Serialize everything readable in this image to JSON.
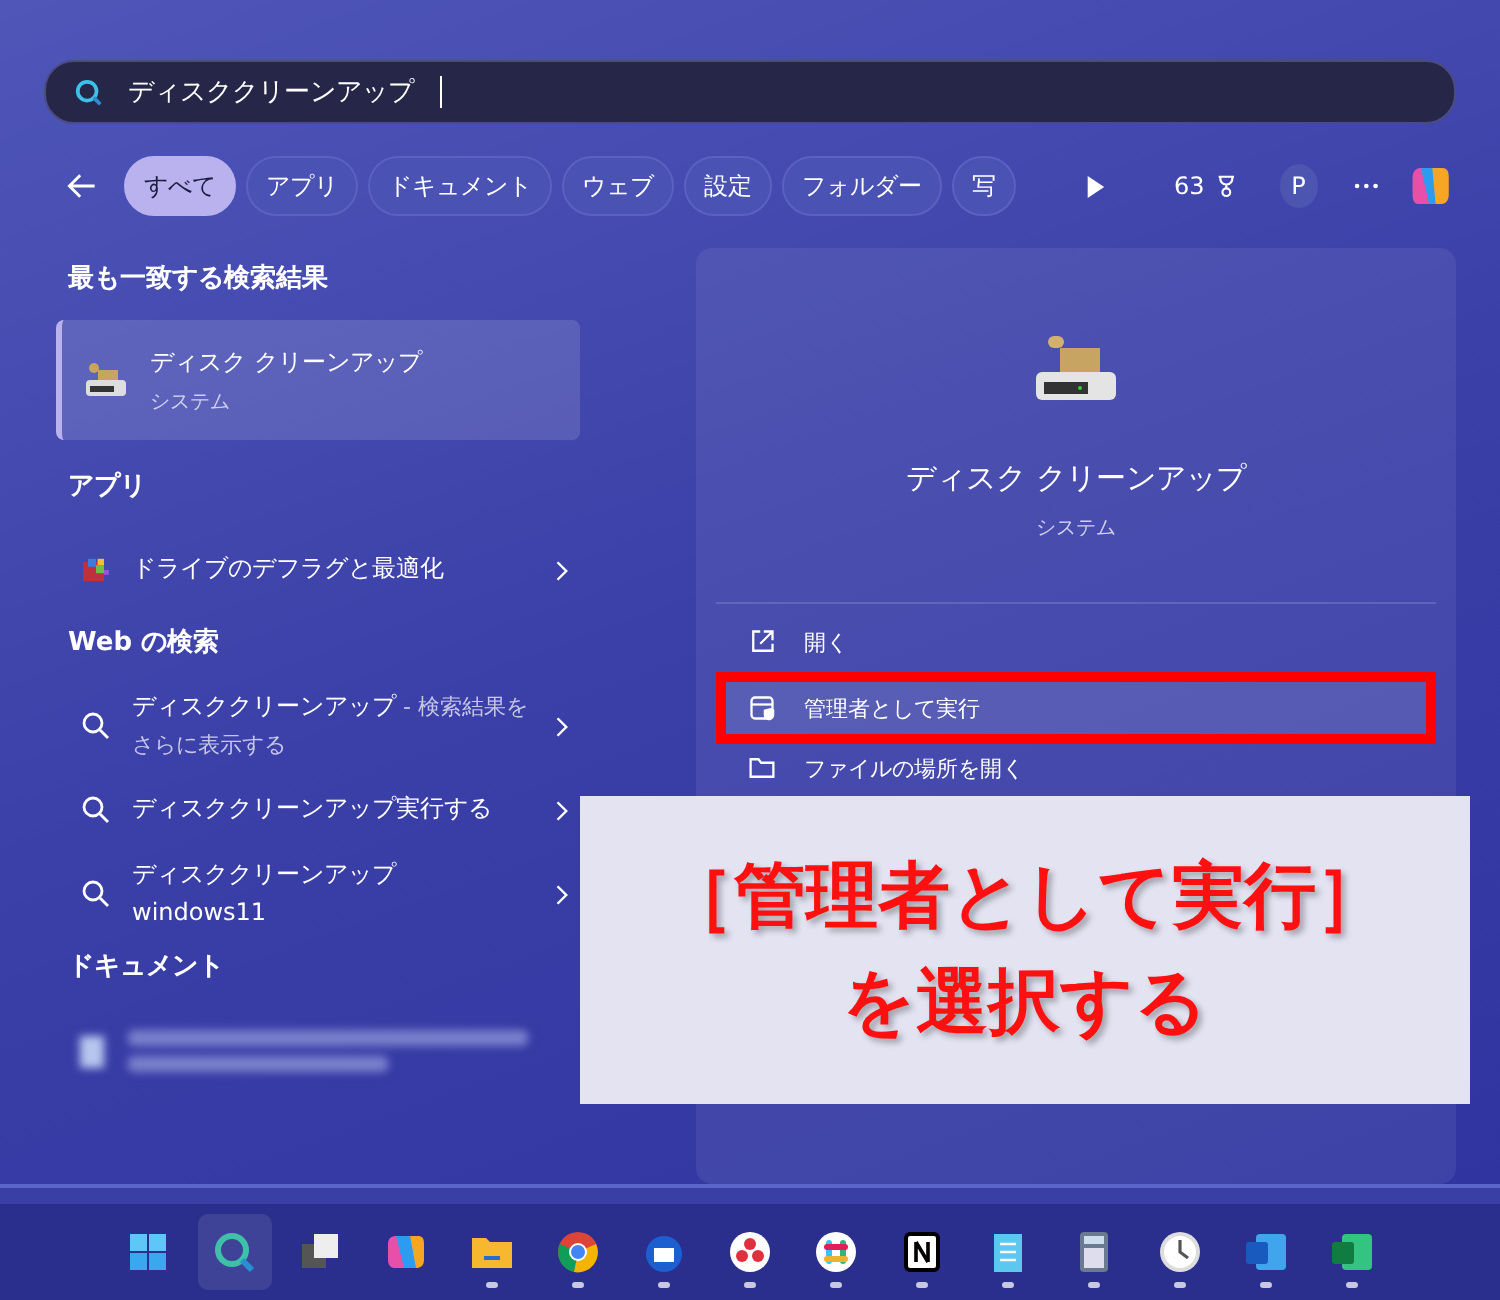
{
  "search": {
    "value": "ディスククリーンアップ"
  },
  "filters": [
    {
      "label": "すべて",
      "selected": true
    },
    {
      "label": "アプリ",
      "selected": false
    },
    {
      "label": "ドキュメント",
      "selected": false
    },
    {
      "label": "ウェブ",
      "selected": false
    },
    {
      "label": "設定",
      "selected": false
    },
    {
      "label": "フォルダー",
      "selected": false
    },
    {
      "label": "写",
      "selected": false
    }
  ],
  "points": "63",
  "account_initial": "P",
  "best_match": {
    "heading": "最も一致する検索結果",
    "title": "ディスク クリーンアップ",
    "subtitle": "システム",
    "selected": true
  },
  "apps": {
    "heading": "アプリ",
    "items": [
      {
        "title": "ドライブのデフラグと最適化"
      }
    ]
  },
  "web": {
    "heading": "Web の検索",
    "items": [
      {
        "title": "ディスククリーンアップ",
        "suffix": " - 検索結果をさらに表示する"
      },
      {
        "title": "ディスククリーンアップ実行する"
      },
      {
        "title": "ディスククリーンアップ windows11"
      }
    ]
  },
  "documents": {
    "heading": "ドキュメント"
  },
  "detail": {
    "title": "ディスク クリーンアップ",
    "subtitle": "システム",
    "actions": [
      {
        "kind": "open",
        "label": "開く",
        "highlighted": false
      },
      {
        "kind": "admin",
        "label": "管理者として実行",
        "highlighted": true
      },
      {
        "kind": "folder",
        "label": "ファイルの場所を開く",
        "highlighted": false
      }
    ]
  },
  "callout": {
    "lines": [
      "［管理者として実行］",
      "を選択する"
    ]
  },
  "taskbar": [
    {
      "selected": false,
      "running": false
    },
    {
      "selected": true,
      "running": false
    },
    {
      "selected": false,
      "running": false
    },
    {
      "selected": false,
      "running": false
    },
    {
      "selected": false,
      "running": true
    },
    {
      "selected": false,
      "running": true
    },
    {
      "selected": false,
      "running": true
    },
    {
      "selected": false,
      "running": true
    },
    {
      "selected": false,
      "running": true
    },
    {
      "selected": false,
      "running": true
    },
    {
      "selected": false,
      "running": true
    },
    {
      "selected": false,
      "running": true
    },
    {
      "selected": false,
      "running": true
    },
    {
      "selected": false,
      "running": true
    },
    {
      "selected": false,
      "running": true
    }
  ]
}
